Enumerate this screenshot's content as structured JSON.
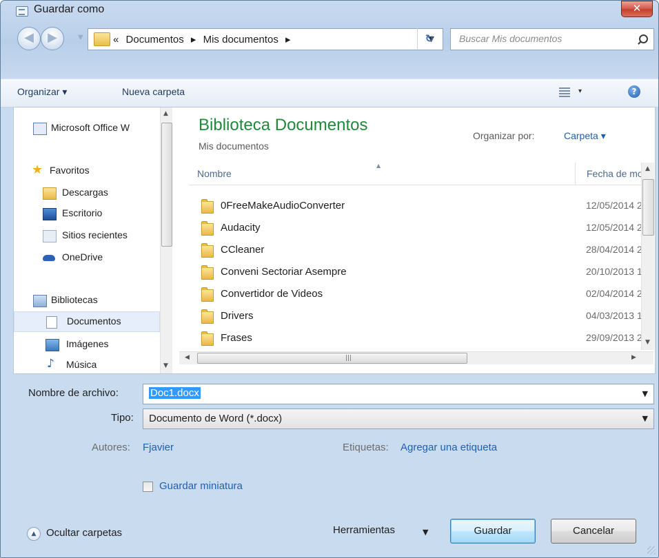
{
  "window": {
    "title": "Guardar como",
    "close_glyph": "✕"
  },
  "address": {
    "back_icon": "back-arrow-icon",
    "forward_icon": "forward-arrow-icon",
    "overflow": "«",
    "crumbs": [
      "Documentos",
      "Mis documentos"
    ],
    "separator": "▸",
    "search_placeholder": "Buscar Mis documentos"
  },
  "toolbar": {
    "organize": "Organizar ▾",
    "new_folder": "Nueva carpeta",
    "views_drop": "▾",
    "help": "?"
  },
  "sidebar": {
    "items": [
      {
        "label": "Microsoft Office W",
        "icon": "word-icon"
      },
      {
        "label": "Favoritos",
        "icon": "star-icon"
      },
      {
        "label": "Descargas",
        "icon": "downloads-folder-icon"
      },
      {
        "label": "Escritorio",
        "icon": "desktop-icon"
      },
      {
        "label": "Sitios recientes",
        "icon": "recent-places-icon"
      },
      {
        "label": "OneDrive",
        "icon": "cloud-icon"
      },
      {
        "label": "Bibliotecas",
        "icon": "libraries-icon"
      },
      {
        "label": "Documentos",
        "icon": "document-icon",
        "selected": true
      },
      {
        "label": "Imágenes",
        "icon": "pictures-icon"
      },
      {
        "label": "Música",
        "icon": "music-icon"
      }
    ]
  },
  "library": {
    "title": "Biblioteca Documentos",
    "subtitle": "Mis documentos",
    "arrange_label": "Organizar por:",
    "arrange_value": "Carpeta ▾",
    "col_name": "Nombre",
    "col_date": "Fecha de mo"
  },
  "files": [
    {
      "name": "0FreeMakeAudioConverter",
      "date": "12/05/2014 2"
    },
    {
      "name": "Audacity",
      "date": "12/05/2014 2"
    },
    {
      "name": "CCleaner",
      "date": "28/04/2014 2"
    },
    {
      "name": "Conveni Sectoriar Asempre",
      "date": "20/10/2013 1"
    },
    {
      "name": "Convertidor de Videos",
      "date": "02/04/2014 2"
    },
    {
      "name": "Drivers",
      "date": "04/03/2013 1"
    },
    {
      "name": "Frases",
      "date": "29/09/2013 2"
    }
  ],
  "form": {
    "filename_label": "Nombre de archivo:",
    "filename_value": "Doc1.docx",
    "type_label": "Tipo:",
    "type_value": "Documento de Word (*.docx)",
    "authors_label": "Autores:",
    "authors_value": "Fjavier",
    "tags_label": "Etiquetas:",
    "tags_value": "Agregar una etiqueta",
    "thumbnail_label": "Guardar miniatura"
  },
  "footer": {
    "hide_folders": "Ocultar carpetas",
    "tools": "Herramientas",
    "save": "Guardar",
    "cancel": "Cancelar"
  },
  "colors": {
    "title_green": "#1e8a3a",
    "link_blue": "#1f5fb0",
    "selection": "#3399ff"
  }
}
